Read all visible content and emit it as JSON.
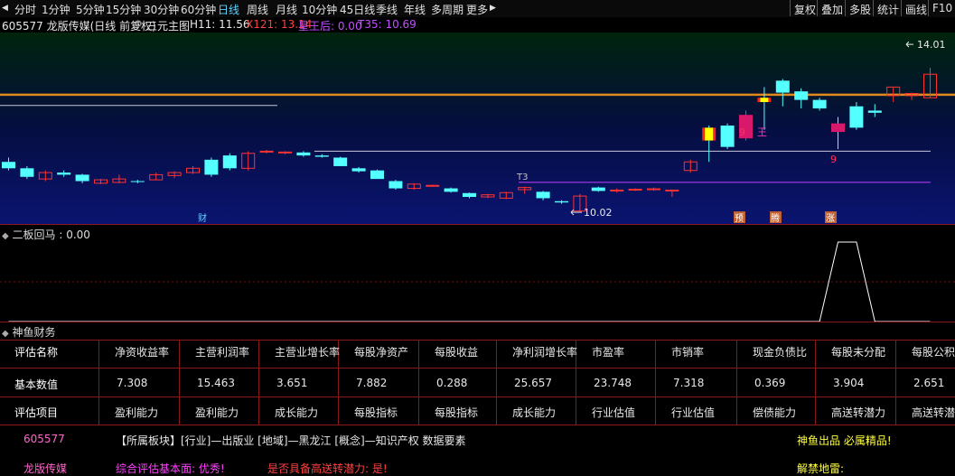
{
  "toolbar": {
    "periods": [
      {
        "label": "分时",
        "active": false
      },
      {
        "label": "1分钟",
        "active": false
      },
      {
        "label": "5分钟",
        "active": false
      },
      {
        "label": "15分钟",
        "active": false
      },
      {
        "label": "30分钟",
        "active": false
      },
      {
        "label": "60分钟",
        "active": false
      },
      {
        "label": "日线",
        "active": true
      },
      {
        "label": "周线",
        "active": false
      },
      {
        "label": "月线",
        "active": false
      },
      {
        "label": "10分钟",
        "active": false
      },
      {
        "label": "45日线",
        "active": false
      },
      {
        "label": "季线",
        "active": false
      },
      {
        "label": "年线",
        "active": false
      },
      {
        "label": "多周期",
        "active": false
      },
      {
        "label": "更多",
        "active": false
      }
    ],
    "buttons": [
      "复权",
      "叠加",
      "多股",
      "统计",
      "画线",
      "F10"
    ]
  },
  "infobar": {
    "stock": "605577 龙版传媒(日线 前复权)",
    "indicator": "三元主图",
    "h11": "H11: 11.56",
    "x121": "X121: 13.14",
    "xingwang": "星王后: 0.00",
    "t35": "T35: 10.69"
  },
  "colors": {
    "up": "#ff3232",
    "down": "#54ffff",
    "orange": "#e08a1e",
    "magenta": "#d8186a",
    "yellow": "#ffff00",
    "purple": "#c040ff",
    "grid": "#7a1010"
  },
  "main_chart": {
    "price_labels": {
      "high": "14.01",
      "low": "10.02",
      "t3": "T3"
    },
    "markers": [
      {
        "text": "9",
        "color": "#ff3060"
      },
      {
        "text": "王",
        "color": "#ff30c0"
      },
      {
        "text": "9",
        "color": "#ff3060"
      }
    ],
    "badges": [
      {
        "text": "财"
      },
      {
        "text": "预"
      },
      {
        "text": "腾"
      },
      {
        "text": "涨"
      }
    ]
  },
  "sub_chart": {
    "title": "二板回马 : 0.00"
  },
  "fin_section": {
    "title": "神鱼财务"
  },
  "fin_table": {
    "headers": [
      "评估名称",
      "净资收益率",
      "主营利润率",
      "主营业增长率",
      "每股净资产",
      "每股收益",
      "净利润增长率",
      "市盈率",
      "市销率",
      "现金负债比",
      "每股未分配",
      "每股公积金"
    ],
    "values": [
      "基本数值",
      "7.308",
      "15.463",
      "3.651",
      "7.882",
      "0.288",
      "25.657",
      "23.748",
      "7.318",
      "0.369",
      "3.904",
      "2.651"
    ],
    "items": [
      "评估项目",
      "盈利能力",
      "盈利能力",
      "成长能力",
      "每股指标",
      "每股指标",
      "成长能力",
      "行业估值",
      "行业估值",
      "偿债能力",
      "高送转潜力",
      "高送转潜力"
    ]
  },
  "footer": {
    "code": "605577",
    "name": "龙版传媒",
    "sector": "【所属板块】[行业]—出版业 [地域]—黑龙江 [概念]—知识产权 数据要素",
    "slogan": "神鱼出品 必属精品!",
    "rating": "综合评估基本面: 优秀!",
    "gaosong": "是否具备高送转潜力: 是!",
    "thunder": "解禁地雷:"
  },
  "chart_data": {
    "type": "candlestick",
    "ohlc": [
      [
        11.2,
        11.3,
        11.0,
        11.05
      ],
      [
        11.05,
        11.1,
        10.8,
        10.85
      ],
      [
        10.8,
        11.0,
        10.75,
        10.95
      ],
      [
        10.95,
        11.0,
        10.85,
        10.9
      ],
      [
        10.9,
        10.92,
        10.7,
        10.75
      ],
      [
        10.7,
        10.8,
        10.68,
        10.78
      ],
      [
        10.72,
        10.9,
        10.7,
        10.8
      ],
      [
        10.75,
        10.78,
        10.7,
        10.74
      ],
      [
        10.78,
        10.95,
        10.78,
        10.9
      ],
      [
        10.88,
        10.98,
        10.82,
        10.95
      ],
      [
        10.95,
        11.1,
        10.92,
        11.05
      ],
      [
        11.25,
        11.3,
        10.85,
        10.9
      ],
      [
        11.35,
        11.4,
        11.0,
        11.05
      ],
      [
        11.05,
        11.45,
        11.0,
        11.4
      ],
      [
        11.45,
        11.48,
        11.4,
        11.45
      ],
      [
        11.42,
        11.45,
        11.38,
        11.43
      ],
      [
        11.42,
        11.45,
        11.32,
        11.35
      ],
      [
        11.35,
        11.38,
        11.3,
        11.32
      ],
      [
        11.3,
        11.32,
        11.1,
        11.1
      ],
      [
        11.05,
        11.08,
        10.95,
        10.98
      ],
      [
        11.0,
        11.02,
        10.8,
        10.8
      ],
      [
        10.75,
        10.78,
        10.55,
        10.58
      ],
      [
        10.58,
        10.7,
        10.55,
        10.68
      ],
      [
        10.65,
        10.67,
        10.62,
        10.65
      ],
      [
        10.58,
        10.6,
        10.48,
        10.5
      ],
      [
        10.47,
        10.48,
        10.35,
        10.38
      ],
      [
        10.38,
        10.45,
        10.35,
        10.43
      ],
      [
        10.35,
        10.5,
        10.33,
        10.48
      ],
      [
        10.55,
        10.62,
        10.45,
        10.6
      ],
      [
        10.5,
        10.52,
        10.3,
        10.35
      ],
      [
        10.28,
        10.3,
        10.22,
        10.25
      ],
      [
        10.05,
        10.45,
        10.02,
        10.4
      ],
      [
        10.6,
        10.62,
        10.5,
        10.52
      ],
      [
        10.52,
        10.58,
        10.48,
        10.54
      ],
      [
        10.55,
        10.58,
        10.52,
        10.56
      ],
      [
        10.55,
        10.6,
        10.52,
        10.57
      ],
      [
        10.52,
        10.55,
        10.38,
        10.54
      ],
      [
        11.0,
        11.25,
        10.95,
        11.2
      ],
      [
        12.0,
        12.05,
        11.2,
        11.7
      ],
      [
        12.05,
        12.1,
        11.5,
        11.55
      ],
      [
        11.75,
        12.4,
        11.7,
        12.3
      ],
      [
        12.7,
        12.95,
        11.95,
        12.6
      ],
      [
        13.1,
        13.14,
        12.5,
        12.82
      ],
      [
        12.85,
        12.92,
        12.45,
        12.65
      ],
      [
        12.65,
        12.7,
        12.4,
        12.45
      ],
      [
        12.1,
        12.25,
        11.5,
        11.9
      ],
      [
        12.5,
        12.6,
        11.95,
        12.0
      ],
      [
        12.4,
        12.55,
        12.25,
        12.35
      ],
      [
        12.75,
        12.95,
        12.6,
        12.95
      ],
      [
        12.75,
        12.82,
        12.65,
        12.8
      ],
      [
        12.7,
        13.4,
        12.7,
        13.25
      ]
    ],
    "lines": [
      {
        "name": "H11",
        "value": 11.56
      },
      {
        "name": "X121",
        "value": 13.14
      },
      {
        "name": "T35",
        "value": 10.69
      }
    ],
    "ylim": [
      10.0,
      14.1
    ],
    "sub_indicator": {
      "values": [
        0,
        0,
        0,
        0,
        0,
        0,
        0,
        0,
        0,
        0,
        0,
        0,
        0,
        0,
        0,
        0,
        0,
        0,
        0,
        0,
        0,
        0,
        0,
        0,
        0,
        0,
        0,
        0,
        0,
        0,
        0,
        0,
        0,
        0,
        0,
        0,
        0,
        0,
        0,
        0,
        0,
        0,
        0,
        0,
        0,
        1,
        1,
        0,
        0,
        0,
        0
      ],
      "ylim": [
        0,
        1
      ]
    }
  }
}
